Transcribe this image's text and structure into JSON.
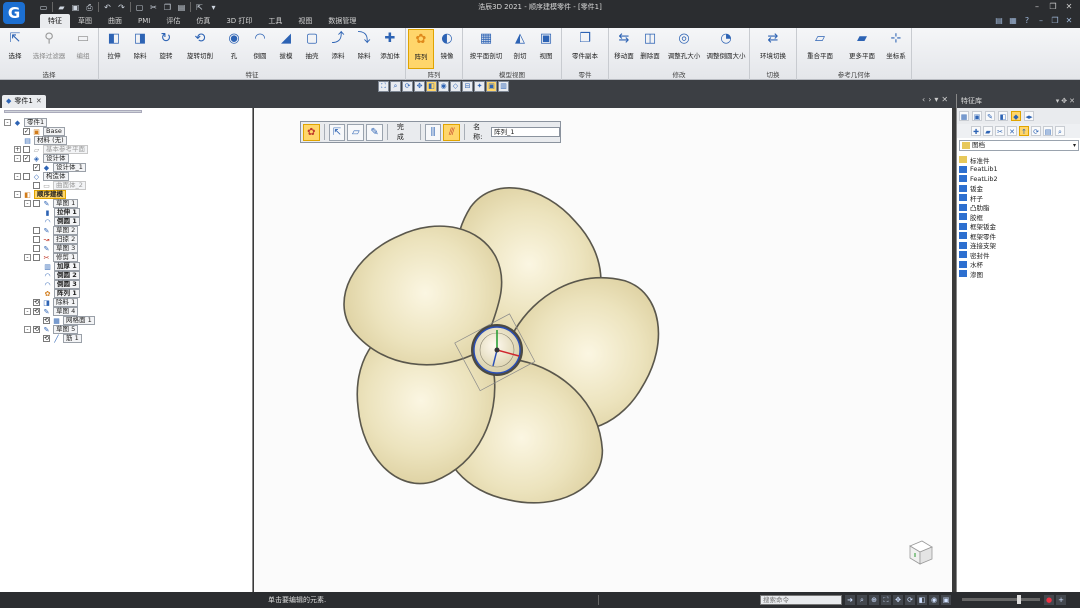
{
  "app": {
    "logo_text": "G",
    "window_title": "浩辰3D 2021 - 顺序建模零件 - [零件1]"
  },
  "ribbon_tabs": [
    "特征",
    "草图",
    "曲面",
    "PMI",
    "评估",
    "仿真",
    "3D 打印",
    "工具",
    "视图",
    "数据管理"
  ],
  "ribbon_groups": [
    {
      "label": "选择",
      "buttons": [
        {
          "label": "选择",
          "icon": "select-arrow-icon"
        },
        {
          "label": "选择过滤器",
          "icon": "filter-icon",
          "disabled": true
        },
        {
          "label": "编组",
          "icon": "group-icon",
          "disabled": true
        }
      ]
    },
    {
      "label": "特征",
      "buttons": [
        {
          "label": "拉伸",
          "icon": "extrude-icon"
        },
        {
          "label": "除料",
          "icon": "cut-icon"
        },
        {
          "label": "旋转",
          "icon": "revolve-icon"
        },
        {
          "label": "旋转切削",
          "icon": "revolve-cut-icon"
        },
        {
          "label": "孔",
          "icon": "hole-icon"
        },
        {
          "label": "倒圆",
          "icon": "round-icon"
        },
        {
          "label": "拔模",
          "icon": "draft-icon"
        },
        {
          "label": "抽壳",
          "icon": "shell-icon"
        },
        {
          "label": "添料",
          "icon": "add-material-icon"
        },
        {
          "label": "除料",
          "icon": "remove-material-icon"
        },
        {
          "label": "添加体",
          "icon": "add-body-icon"
        }
      ]
    },
    {
      "label": "阵列",
      "buttons": [
        {
          "label": "阵列",
          "icon": "pattern-icon",
          "active": true
        },
        {
          "label": "镜像",
          "icon": "mirror-icon"
        }
      ]
    },
    {
      "label": "模型视图",
      "buttons": [
        {
          "label": "按平面剖切",
          "icon": "section-plane-icon"
        },
        {
          "label": "剖切",
          "icon": "section-icon"
        },
        {
          "label": "视图",
          "icon": "view-icon"
        }
      ]
    },
    {
      "label": "零件",
      "buttons": [
        {
          "label": "零件副本",
          "icon": "part-copy-icon"
        }
      ]
    },
    {
      "label": "修改",
      "buttons": [
        {
          "label": "移动面",
          "icon": "move-face-icon"
        },
        {
          "label": "删除面",
          "icon": "delete-face-icon"
        },
        {
          "label": "调整孔大小",
          "icon": "resize-hole-icon"
        },
        {
          "label": "调整倒圆大小",
          "icon": "resize-round-icon"
        }
      ]
    },
    {
      "label": "切换",
      "buttons": [
        {
          "label": "环境切换",
          "icon": "env-switch-icon"
        }
      ]
    },
    {
      "label": "参考几何体",
      "buttons": [
        {
          "label": "重合平面",
          "icon": "coincident-plane-icon"
        },
        {
          "label": "更多平面",
          "icon": "more-planes-icon"
        },
        {
          "label": "坐标系",
          "icon": "coordinate-system-icon"
        }
      ]
    }
  ],
  "doc_tab": "零件1",
  "tree": [
    {
      "level": 0,
      "exp": "-",
      "chk": null,
      "icon": "part-icon",
      "label": "零件1",
      "style": "plain"
    },
    {
      "level": 1,
      "exp": null,
      "chk": "✓",
      "icon": "base-icon",
      "label": "Base",
      "style": "plain"
    },
    {
      "level": 1,
      "exp": null,
      "chk": null,
      "icon": "material-icon",
      "label": "材料 (无)",
      "style": "plain"
    },
    {
      "level": 1,
      "exp": "+",
      "chk": "",
      "icon": "ref-plane-icon",
      "label": "基本参考平面",
      "style": "dim"
    },
    {
      "level": 1,
      "exp": "-",
      "chk": "✓",
      "icon": "design-body-icon",
      "label": "设计体",
      "style": "plain"
    },
    {
      "level": 2,
      "exp": null,
      "chk": "✓",
      "icon": "body-icon",
      "label": "设计体_1",
      "style": "plain"
    },
    {
      "level": 1,
      "exp": "-",
      "chk": "",
      "icon": "construction-icon",
      "label": "构造体",
      "style": "plain"
    },
    {
      "level": 2,
      "exp": null,
      "chk": "",
      "icon": "surface-icon",
      "label": "曲面体_2",
      "style": "dim"
    },
    {
      "level": 1,
      "exp": "-",
      "chk": null,
      "icon": "ordered-icon",
      "label": "顺序建模",
      "style": "hl"
    },
    {
      "level": 2,
      "exp": "-",
      "chk": "",
      "icon": "sketch-icon",
      "label": "草图 1",
      "style": "plain"
    },
    {
      "level": 3,
      "exp": null,
      "chk": null,
      "icon": "extrude-icon",
      "label": "拉伸 1",
      "style": "bold"
    },
    {
      "level": 3,
      "exp": null,
      "chk": null,
      "icon": "round-icon",
      "label": "倒圆 1",
      "style": "bold"
    },
    {
      "level": 2,
      "exp": null,
      "chk": "",
      "icon": "sketch-icon",
      "label": "草图 2",
      "style": "plain"
    },
    {
      "level": 2,
      "exp": null,
      "chk": "",
      "icon": "sweep-icon",
      "label": "扫掠 2",
      "style": "plain"
    },
    {
      "level": 2,
      "exp": null,
      "chk": "",
      "icon": "sketch-icon",
      "label": "草图 3",
      "style": "plain"
    },
    {
      "level": 2,
      "exp": "-",
      "chk": "",
      "icon": "trim-icon",
      "label": "修剪 1",
      "style": "plain"
    },
    {
      "level": 3,
      "exp": null,
      "chk": null,
      "icon": "thicken-icon",
      "label": "加厚 1",
      "style": "bold"
    },
    {
      "level": 3,
      "exp": null,
      "chk": null,
      "icon": "round-icon",
      "label": "倒圆 2",
      "style": "bold"
    },
    {
      "level": 3,
      "exp": null,
      "chk": null,
      "icon": "round-icon",
      "label": "倒圆 3",
      "style": "bold"
    },
    {
      "level": 3,
      "exp": null,
      "chk": null,
      "icon": "pattern-icon",
      "label": "阵列 1",
      "style": "bold"
    },
    {
      "level": 2,
      "exp": null,
      "chk": "⟲",
      "icon": "cut-icon",
      "label": "除料 1",
      "style": "plain"
    },
    {
      "level": 2,
      "exp": "-",
      "chk": "⟲",
      "icon": "sketch-icon",
      "label": "草图 4",
      "style": "plain"
    },
    {
      "level": 3,
      "exp": null,
      "chk": "⟲",
      "icon": "mesh-icon",
      "label": "网格面 1",
      "style": "plain"
    },
    {
      "level": 2,
      "exp": "-",
      "chk": "⟲",
      "icon": "sketch-icon",
      "label": "草图 5",
      "style": "plain"
    },
    {
      "level": 3,
      "exp": null,
      "chk": "⟲",
      "icon": "rib-icon",
      "label": "筋 1",
      "style": "plain"
    }
  ],
  "cmdbar": {
    "done_label": "完成",
    "name_label": "名称:",
    "name_value": "阵列_1"
  },
  "feature_library": {
    "title": "特征库",
    "combo_value": "图档",
    "items": [
      {
        "label": "标准件",
        "type": "folder"
      },
      {
        "label": "FeatLib1",
        "type": "lib"
      },
      {
        "label": "FeatLib2",
        "type": "lib"
      },
      {
        "label": "钣金",
        "type": "lib"
      },
      {
        "label": "杆子",
        "type": "lib"
      },
      {
        "label": "凸肋脂",
        "type": "lib"
      },
      {
        "label": "胶框",
        "type": "lib"
      },
      {
        "label": "框架钣金",
        "type": "lib"
      },
      {
        "label": "框架零件",
        "type": "lib"
      },
      {
        "label": "连接支架",
        "type": "lib"
      },
      {
        "label": "密封件",
        "type": "lib"
      },
      {
        "label": "水杯",
        "type": "lib"
      },
      {
        "label": "渗图",
        "type": "lib"
      }
    ]
  },
  "status": {
    "message": "单击要编辑的元素.",
    "search_placeholder": "搜索命令"
  },
  "colors": {
    "blade_fill": "#e9dfb5",
    "blade_edge": "#5a574c",
    "active_orange": "#ffd66b",
    "dark_chrome": "#2b2d30",
    "accent_blue": "#2d63b4"
  }
}
